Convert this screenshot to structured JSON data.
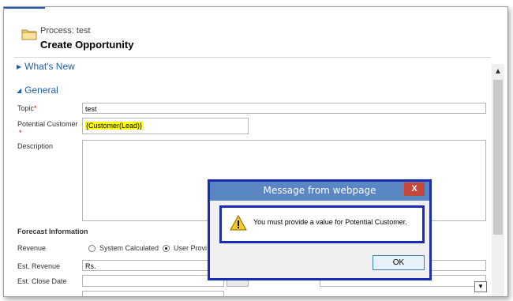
{
  "header": {
    "process_label": "Process: test",
    "title": "Create Opportunity"
  },
  "sections": {
    "whats_new": "What's New",
    "general": "General",
    "forecast": "Forecast Information"
  },
  "fields": {
    "topic_label": "Topic",
    "topic_value": "test",
    "potential_customer_label": "Potential Customer",
    "potential_customer_value": "{Customer(Lead)}",
    "description_label": "Description",
    "revenue_label": "Revenue",
    "revenue_opt1": "System Calculated",
    "revenue_opt2": "User Provi",
    "est_revenue_label": "Est. Revenue",
    "est_revenue_value": "Rs.",
    "est_close_label": "Est. Close Date",
    "required_mark": "*"
  },
  "dialog": {
    "title": "Message from webpage",
    "close": "X",
    "message": "You must provide a value for Potential Customer.",
    "ok": "OK"
  }
}
